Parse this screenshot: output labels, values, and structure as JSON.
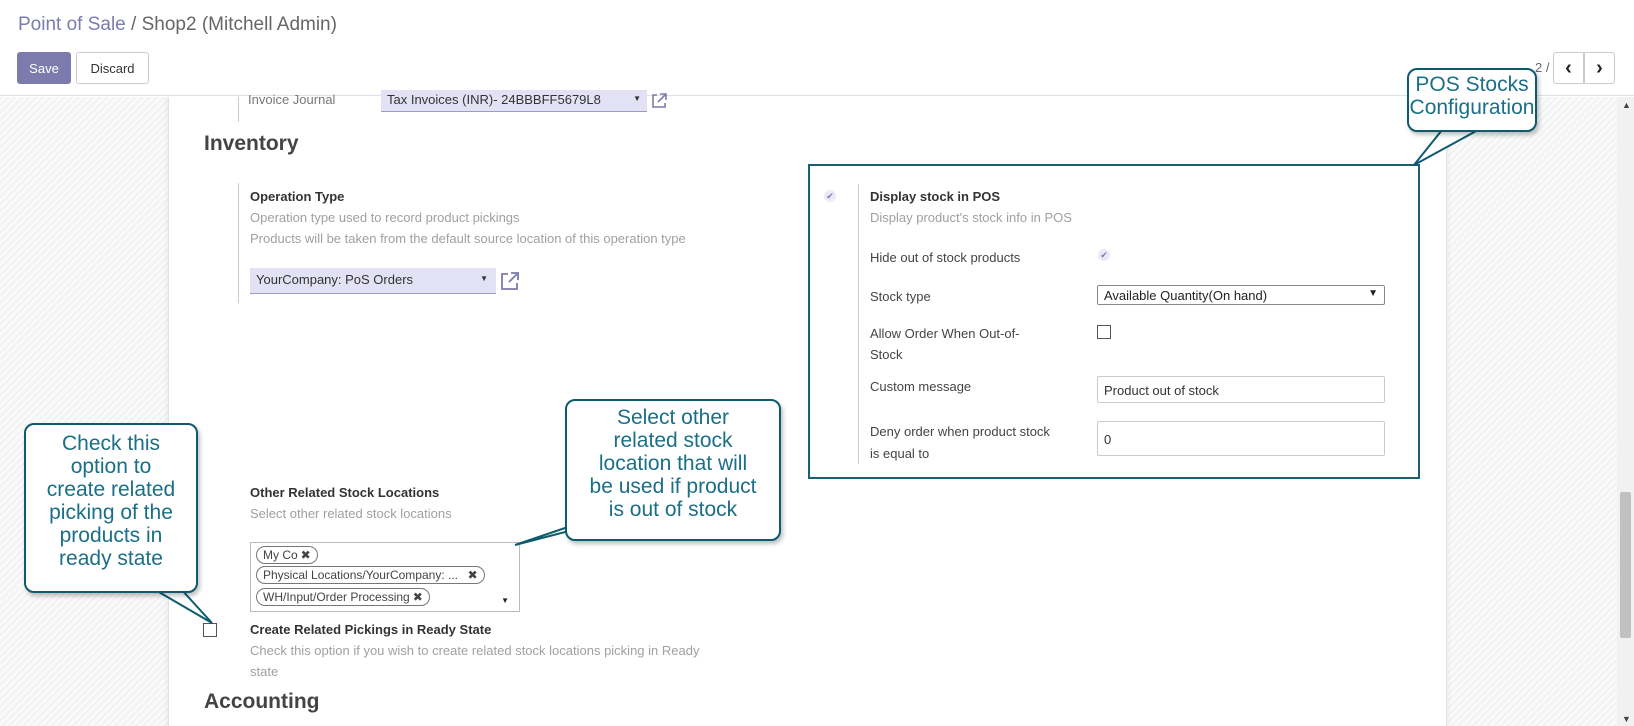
{
  "breadcrumb": {
    "parent": "Point of Sale",
    "separator": "/",
    "current": "Shop2 (Mitchell Admin)"
  },
  "buttons": {
    "save": "Save",
    "discard": "Discard"
  },
  "pager": {
    "text": "2 / 2",
    "prev": "‹",
    "next": "›"
  },
  "invoice": {
    "label": "Invoice Journal",
    "value": "Tax Invoices (INR)- 24BBBFF5679L8"
  },
  "inventory": {
    "title": "Inventory",
    "operation_type": {
      "label": "Operation Type",
      "help1": "Operation type used to record product pickings",
      "help2": "Products will be taken from the default source location of this operation type",
      "value": "YourCompany: PoS Orders"
    },
    "other_locations": {
      "label": "Other Related Stock Locations",
      "help": "Select other related stock locations",
      "tags": [
        "My Co",
        "Physical Locations/YourCompany: ...",
        "WH/Input/Order Processing"
      ]
    },
    "ready_state": {
      "label": "Create Related Pickings in Ready State",
      "help1": "Check this option if you wish to create related stock locations picking in Ready",
      "help2": "state",
      "checked": false
    }
  },
  "pos_stock": {
    "display_label": "Display stock in POS",
    "display_help": "Display product's stock info in POS",
    "display_checked": true,
    "hide_oos_label": "Hide out of stock products",
    "hide_oos_checked": true,
    "stock_type_label": "Stock type",
    "stock_type_value": "Available Quantity(On hand)",
    "allow_order_label1": "Allow Order When Out-of-",
    "allow_order_label2": "Stock",
    "allow_order_checked": false,
    "custom_message_label": "Custom message",
    "custom_message_value": "Product out of stock",
    "deny_label1": "Deny order when product stock",
    "deny_label2": "is equal to",
    "deny_value": "0"
  },
  "accounting": {
    "title": "Accounting"
  },
  "callouts": {
    "pos_stocks_line1": "POS Stocks",
    "pos_stocks_line2": "Configuration",
    "other_loc": [
      "Select other",
      "related stock",
      "location that will",
      "be used if product",
      "is out of stock"
    ],
    "ready_state": [
      "Check this",
      "option to",
      "create related",
      "picking of the",
      "products in",
      "ready state"
    ]
  },
  "colors": {
    "accent": "#7c7bad",
    "callout_border": "#0e5a6f",
    "callout_text": "#1b6f87"
  }
}
